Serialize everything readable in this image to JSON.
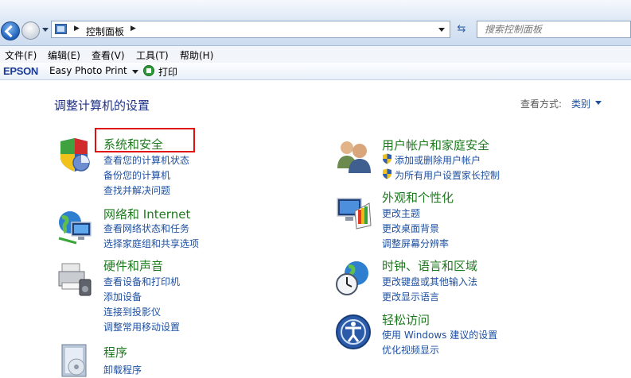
{
  "address": {
    "breadcrumb": "控制面板",
    "search_placeholder": "搜索控制面板"
  },
  "menu": [
    "文件(F)",
    "编辑(E)",
    "查看(V)",
    "工具(T)",
    "帮助(H)"
  ],
  "epson": {
    "logo": "EPSON",
    "app": "Easy Photo Print",
    "print": "打印"
  },
  "content": {
    "title": "调整计算机的设置",
    "view_by_label": "查看方式:",
    "view_by_value": "类别"
  },
  "categories": {
    "security": {
      "title": "系统和安全",
      "links": [
        "查看您的计算机状态",
        "备份您的计算机",
        "查找并解决问题"
      ]
    },
    "network": {
      "title": "网络和 Internet",
      "links": [
        "查看网络状态和任务",
        "选择家庭组和共享选项"
      ]
    },
    "hardware": {
      "title": "硬件和声音",
      "links": [
        "查看设备和打印机",
        "添加设备",
        "连接到投影仪",
        "调整常用移动设置"
      ]
    },
    "programs": {
      "title": "程序",
      "links": [
        "卸载程序"
      ]
    },
    "users": {
      "title": "用户帐户和家庭安全",
      "links": [
        "添加或删除用户帐户",
        "为所有用户设置家长控制"
      ]
    },
    "appearance": {
      "title": "外观和个性化",
      "links": [
        "更改主题",
        "更改桌面背景",
        "调整屏幕分辨率"
      ]
    },
    "clock": {
      "title": "时钟、语言和区域",
      "links": [
        "更改键盘或其他输入法",
        "更改显示语言"
      ]
    },
    "ease": {
      "title": "轻松访问",
      "links": [
        "使用 Windows 建议的设置",
        "优化视频显示"
      ]
    }
  }
}
